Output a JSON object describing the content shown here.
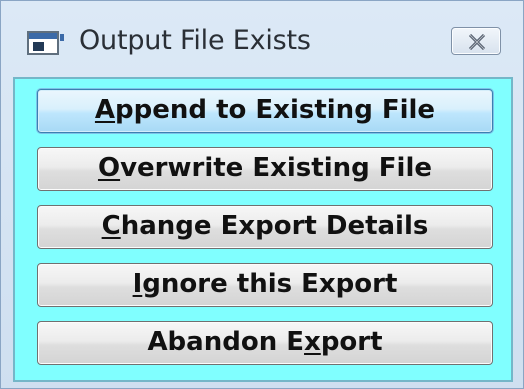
{
  "window": {
    "title": "Output File Exists",
    "icon": "application-window-icon",
    "close_icon": "close-icon"
  },
  "buttons": [
    {
      "name": "append-to-existing-file-button",
      "before": "",
      "accel": "A",
      "after": "ppend to Existing File",
      "focused": true
    },
    {
      "name": "overwrite-existing-file-button",
      "before": "",
      "accel": "O",
      "after": "verwrite Existing File",
      "focused": false
    },
    {
      "name": "change-export-details-button",
      "before": "",
      "accel": "C",
      "after": "hange Export Details",
      "focused": false
    },
    {
      "name": "ignore-this-export-button",
      "before": "",
      "accel": "I",
      "after": "gnore this Export",
      "focused": false
    },
    {
      "name": "abandon-export-button",
      "before": "Abandon E",
      "accel": "x",
      "after": "port",
      "focused": false
    }
  ],
  "colors": {
    "client_background": "#80ffff",
    "focus_accent": "#3c7fb1"
  }
}
